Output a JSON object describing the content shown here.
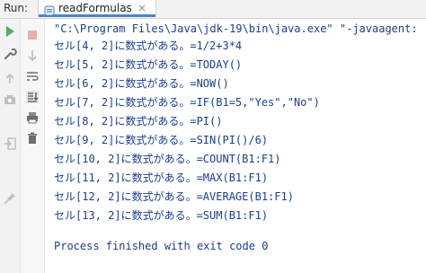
{
  "header": {
    "run_label": "Run:",
    "tab_label": "readFormulas",
    "tab_close": "×"
  },
  "tools": {
    "strip1": [
      "run-icon",
      "wrench-icon",
      "up-arrow-icon",
      "camera-icon",
      "signin-icon",
      "pin-icon"
    ],
    "strip2": [
      "stop-icon",
      "down-arrow-icon",
      "wrap-lines-icon",
      "scroll-end-icon",
      "print-icon",
      "trash-icon"
    ]
  },
  "console": {
    "command": "\"C:\\Program Files\\Java\\jdk-19\\bin\\java.exe\" \"-javaagent:",
    "lines": [
      "セル[4, 2]に数式がある。=1/2+3*4",
      "セル[5, 2]に数式がある。=TODAY()",
      "セル[6, 2]に数式がある。=NOW()",
      "セル[7, 2]に数式がある。=IF(B1=5,\"Yes\",\"No\")",
      "セル[8, 2]に数式がある。=PI()",
      "セル[9, 2]に数式がある。=SIN(PI()/6)",
      "セル[10, 2]に数式がある。=COUNT(B1:F1)",
      "セル[11, 2]に数式がある。=MAX(B1:F1)",
      "セル[12, 2]に数式がある。=AVERAGE(B1:F1)",
      "セル[13, 2]に数式がある。=SUM(B1:F1)"
    ],
    "exit_message": "Process finished with exit code 0"
  },
  "colors": {
    "console_text": "#1a3e8f",
    "run_green": "#59a869",
    "stop_red": "#d9534f",
    "tab_accent": "#4a86c7"
  }
}
